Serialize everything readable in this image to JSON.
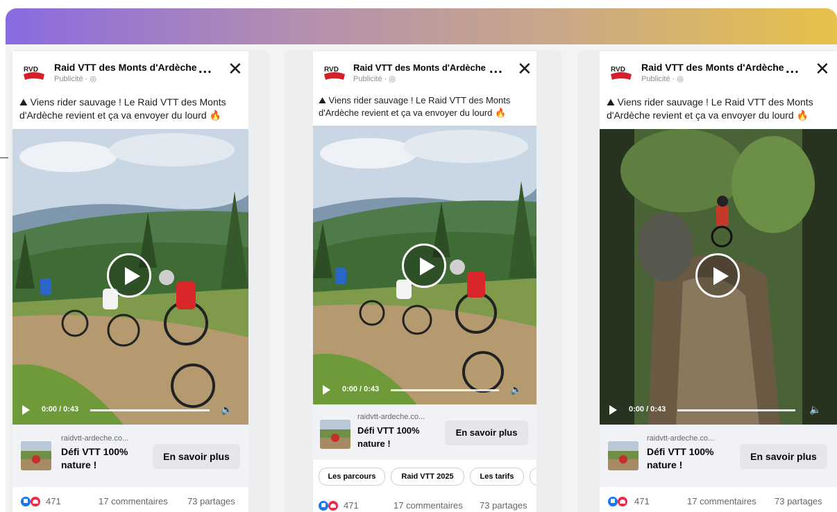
{
  "ad": {
    "page_name": "Raid VTT des Monts d'Ardèche",
    "sponsored": "Publicité · ",
    "more_label": "...",
    "close_label": "✕",
    "caption_line1": "Viens rider sauvage ! Le Raid VTT des Monts",
    "caption_line2": "d'Ardèche revient et ça va envoyer du lourd",
    "video_time": "0:00 / 0:43",
    "domain": "raidvtt-ardeche.co...",
    "headline_line1": "Défi VTT 100%",
    "headline_line2": "nature !",
    "cta_label": "En savoir plus",
    "reactions_count": "471",
    "comments": "17 commentaires",
    "shares": "73 partages"
  },
  "chips": [
    "Les parcours",
    "Raid VTT 2025",
    "Les tarifs"
  ],
  "colors": {
    "banner_start": "#8a6ae0",
    "banner_end": "#e6c24a",
    "like_blue": "#1877f2",
    "love_red": "#f0284a"
  }
}
